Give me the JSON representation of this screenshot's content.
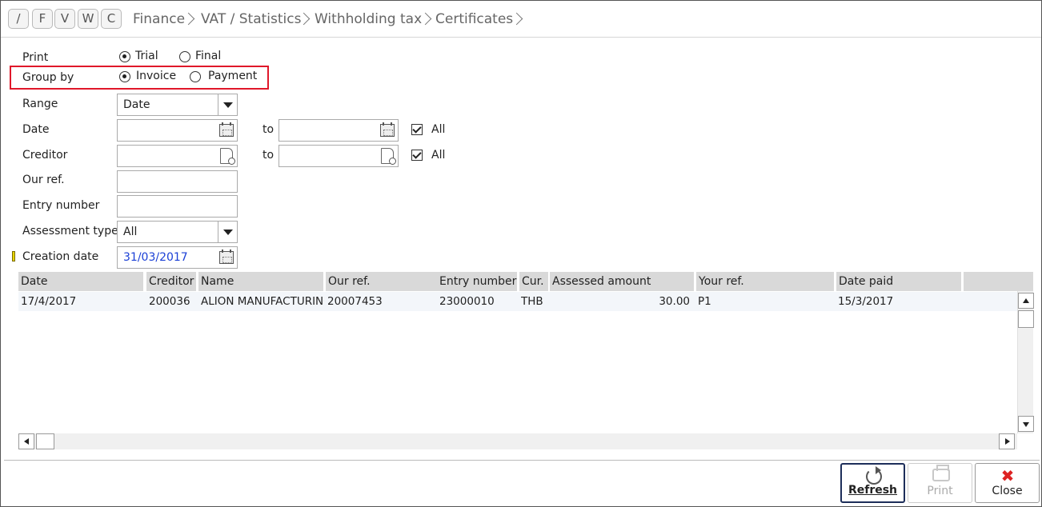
{
  "nav_buttons": [
    "/",
    "F",
    "V",
    "W",
    "C"
  ],
  "breadcrumb": [
    "Finance",
    "VAT / Statistics",
    "Withholding tax",
    "Certificates"
  ],
  "form": {
    "print_label": "Print",
    "print_options": [
      "Trial",
      "Final"
    ],
    "print_selected": "Trial",
    "groupby_label": "Group by",
    "groupby_options": [
      "Invoice",
      "Payment"
    ],
    "groupby_selected": "Invoice",
    "range_label": "Range",
    "range_value": "Date",
    "date_label": "Date",
    "date_from": "",
    "date_to": "",
    "to_label": "to",
    "all_label": "All",
    "date_all_checked": true,
    "creditor_label": "Creditor",
    "creditor_from": "",
    "creditor_to": "",
    "creditor_all_checked": true,
    "ourref_label": "Our ref.",
    "ourref_value": "",
    "entrynumber_label": "Entry number",
    "entrynumber_value": "",
    "assessment_label": "Assessment type",
    "assessment_value": "All",
    "creation_label": "Creation date",
    "creation_value": "31/03/2017"
  },
  "table": {
    "columns": [
      "Date",
      "Creditor",
      "Name",
      "Our ref.",
      "Entry number",
      "Cur.",
      "Assessed amount",
      "Your ref.",
      "Date paid",
      ""
    ],
    "rows": [
      [
        "17/4/2017",
        "200036",
        "ALION MANUFACTURING",
        "20007453",
        "23000010",
        "THB",
        "30.00",
        "P1",
        "15/3/2017"
      ]
    ]
  },
  "actions": {
    "refresh": "Refresh",
    "print": "Print",
    "close": "Close"
  },
  "colors": {
    "highlight_border": "#e0182a",
    "creation_date_text": "#1a3fd6",
    "close_icon": "#dd2222"
  },
  "icons": [
    "calendar-icon",
    "lookup-icon",
    "refresh-icon",
    "printer-icon",
    "close-icon",
    "dropdown-arrow-icon",
    "required-marker-icon"
  ]
}
